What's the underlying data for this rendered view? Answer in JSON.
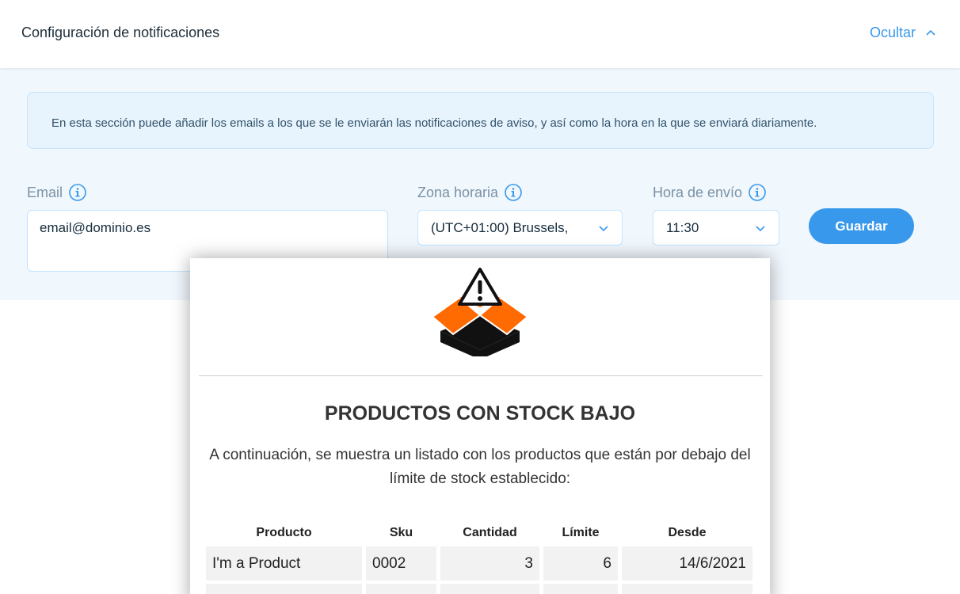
{
  "header": {
    "title": "Configuración de notificaciones",
    "hide_label": "Ocultar"
  },
  "settings": {
    "info_text": "En esta sección puede añadir los emails a los que se le enviarán las notificaciones de aviso, y así como la hora en la que se enviará diariamente.",
    "email": {
      "label": "Email",
      "value": "email@dominio.es"
    },
    "timezone": {
      "label": "Zona horaria",
      "selected": "(UTC+01:00) Brussels,"
    },
    "send_time": {
      "label": "Hora de envío",
      "selected": "11:30"
    },
    "save_label": "Guardar"
  },
  "preview": {
    "title": "PRODUCTOS CON STOCK BAJO",
    "description": "A continuación, se muestra un listado con los productos que están por debajo del límite de stock establecido:",
    "table": {
      "headers": [
        "Producto",
        "Sku",
        "Cantidad",
        "Límite",
        "Desde"
      ],
      "rows": [
        [
          "I'm a Product",
          "0002",
          "3",
          "6",
          "14/6/2021"
        ]
      ]
    }
  },
  "colors": {
    "accent": "#3899ec",
    "logo_orange": "#ff6b00",
    "settings_bg": "#f0f7fd"
  }
}
